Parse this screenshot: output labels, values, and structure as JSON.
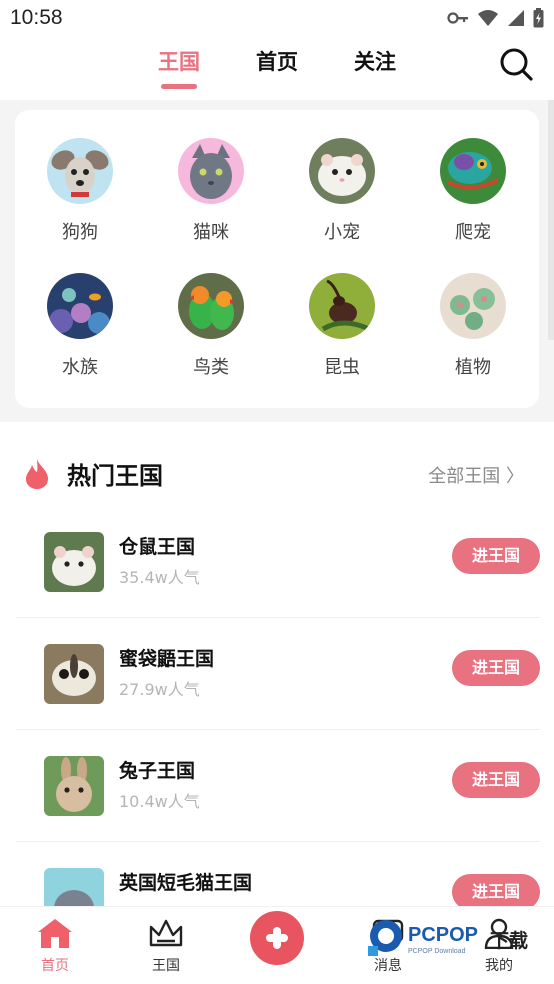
{
  "status": {
    "time": "10:58",
    "icons": [
      "key-icon",
      "wifi-icon",
      "signal-icon",
      "battery-icon"
    ]
  },
  "tabs": [
    {
      "label": "王国",
      "active": true
    },
    {
      "label": "首页",
      "active": false
    },
    {
      "label": "关注",
      "active": false
    }
  ],
  "categories": [
    {
      "label": "狗狗",
      "icon": "dog-icon"
    },
    {
      "label": "猫咪",
      "icon": "cat-icon"
    },
    {
      "label": "小宠",
      "icon": "hamster-icon"
    },
    {
      "label": "爬宠",
      "icon": "chameleon-icon"
    },
    {
      "label": "水族",
      "icon": "reef-icon"
    },
    {
      "label": "鸟类",
      "icon": "parrot-icon"
    },
    {
      "label": "昆虫",
      "icon": "beetle-icon"
    },
    {
      "label": "植物",
      "icon": "succulent-icon"
    }
  ],
  "hot": {
    "title": "热门王国",
    "more": "全部王国 〉"
  },
  "kingdoms": [
    {
      "name": "仓鼠王国",
      "popularity": "35.4w人气",
      "button": "进王国"
    },
    {
      "name": "蜜袋鼯王国",
      "popularity": "27.9w人气",
      "button": "进王国"
    },
    {
      "name": "兔子王国",
      "popularity": "10.4w人气",
      "button": "进王国"
    },
    {
      "name": "英国短毛猫王国",
      "popularity": "",
      "button": "进王国"
    }
  ],
  "nav": [
    {
      "label": "首页",
      "active": true,
      "icon": "home-icon"
    },
    {
      "label": "王国",
      "active": false,
      "icon": "crown-icon"
    },
    {
      "label": "消息",
      "active": false,
      "icon": "message-icon"
    },
    {
      "label": "我的",
      "active": false,
      "icon": "profile-icon"
    }
  ],
  "watermark": {
    "text": "PCPOP",
    "subtext": "PCPOP Download",
    "suffix": "下载"
  },
  "colors": {
    "accent": "#e8727f",
    "fab": "#e8545f",
    "muted": "#b5b5b5"
  }
}
